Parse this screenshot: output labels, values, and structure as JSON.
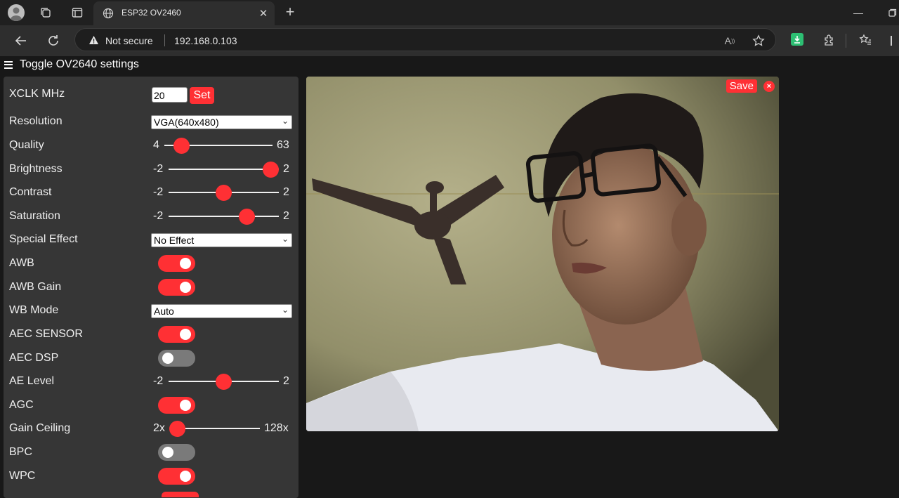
{
  "browser": {
    "tab_title": "ESP32 OV2460",
    "security_label": "Not secure",
    "url": "192.168.0.103"
  },
  "page": {
    "menu_toggle_label": "Toggle OV2640 settings",
    "xclk": {
      "label": "XCLK MHz",
      "value": "20",
      "set_label": "Set"
    },
    "resolution": {
      "label": "Resolution",
      "selected": "VGA(640x480)"
    },
    "quality": {
      "label": "Quality",
      "min": "4",
      "max": "63",
      "value": 10
    },
    "brightness": {
      "label": "Brightness",
      "min": "-2",
      "max": "2",
      "value": 2
    },
    "contrast": {
      "label": "Contrast",
      "min": "-2",
      "max": "2",
      "value": 0
    },
    "saturation": {
      "label": "Saturation",
      "min": "-2",
      "max": "2",
      "value": 1
    },
    "special_effect": {
      "label": "Special Effect",
      "selected": "No Effect"
    },
    "awb": {
      "label": "AWB",
      "on": true
    },
    "awb_gain": {
      "label": "AWB Gain",
      "on": true
    },
    "wb_mode": {
      "label": "WB Mode",
      "selected": "Auto"
    },
    "aec_sensor": {
      "label": "AEC SENSOR",
      "on": true
    },
    "aec_dsp": {
      "label": "AEC DSP",
      "on": false
    },
    "ae_level": {
      "label": "AE Level",
      "min": "-2",
      "max": "2",
      "value": 0
    },
    "agc": {
      "label": "AGC",
      "on": true
    },
    "gain_ceiling": {
      "label": "Gain Ceiling",
      "min": "2x",
      "max": "128x",
      "value": "2x"
    },
    "bpc": {
      "label": "BPC",
      "on": false
    },
    "wpc": {
      "label": "WPC",
      "on": true
    },
    "stream": {
      "save_label": "Save",
      "close_label": "×"
    }
  },
  "colors": {
    "accent": "#ff3034",
    "panel": "#363636",
    "background": "#181818"
  }
}
